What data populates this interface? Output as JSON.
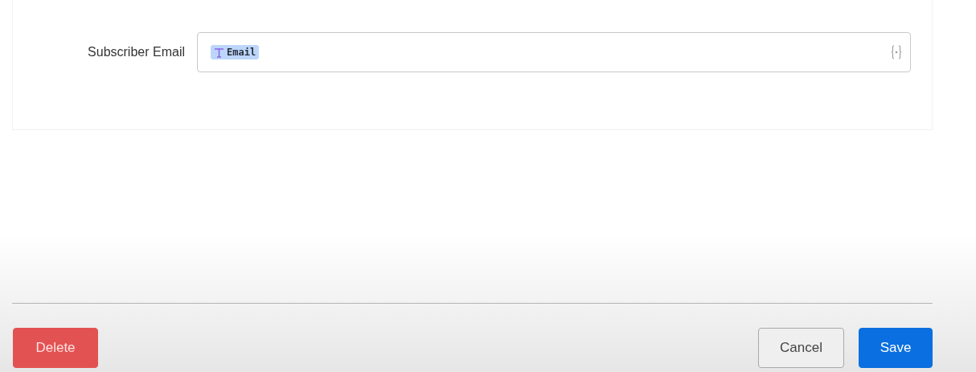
{
  "field": {
    "label": "Subscriber Email",
    "token": "Email"
  },
  "buttons": [
    {
      "kind": "danger",
      "label": "Delete"
    },
    {
      "kind": "secondary",
      "label": "Cancel"
    },
    {
      "kind": "primary",
      "label": "Save"
    }
  ]
}
